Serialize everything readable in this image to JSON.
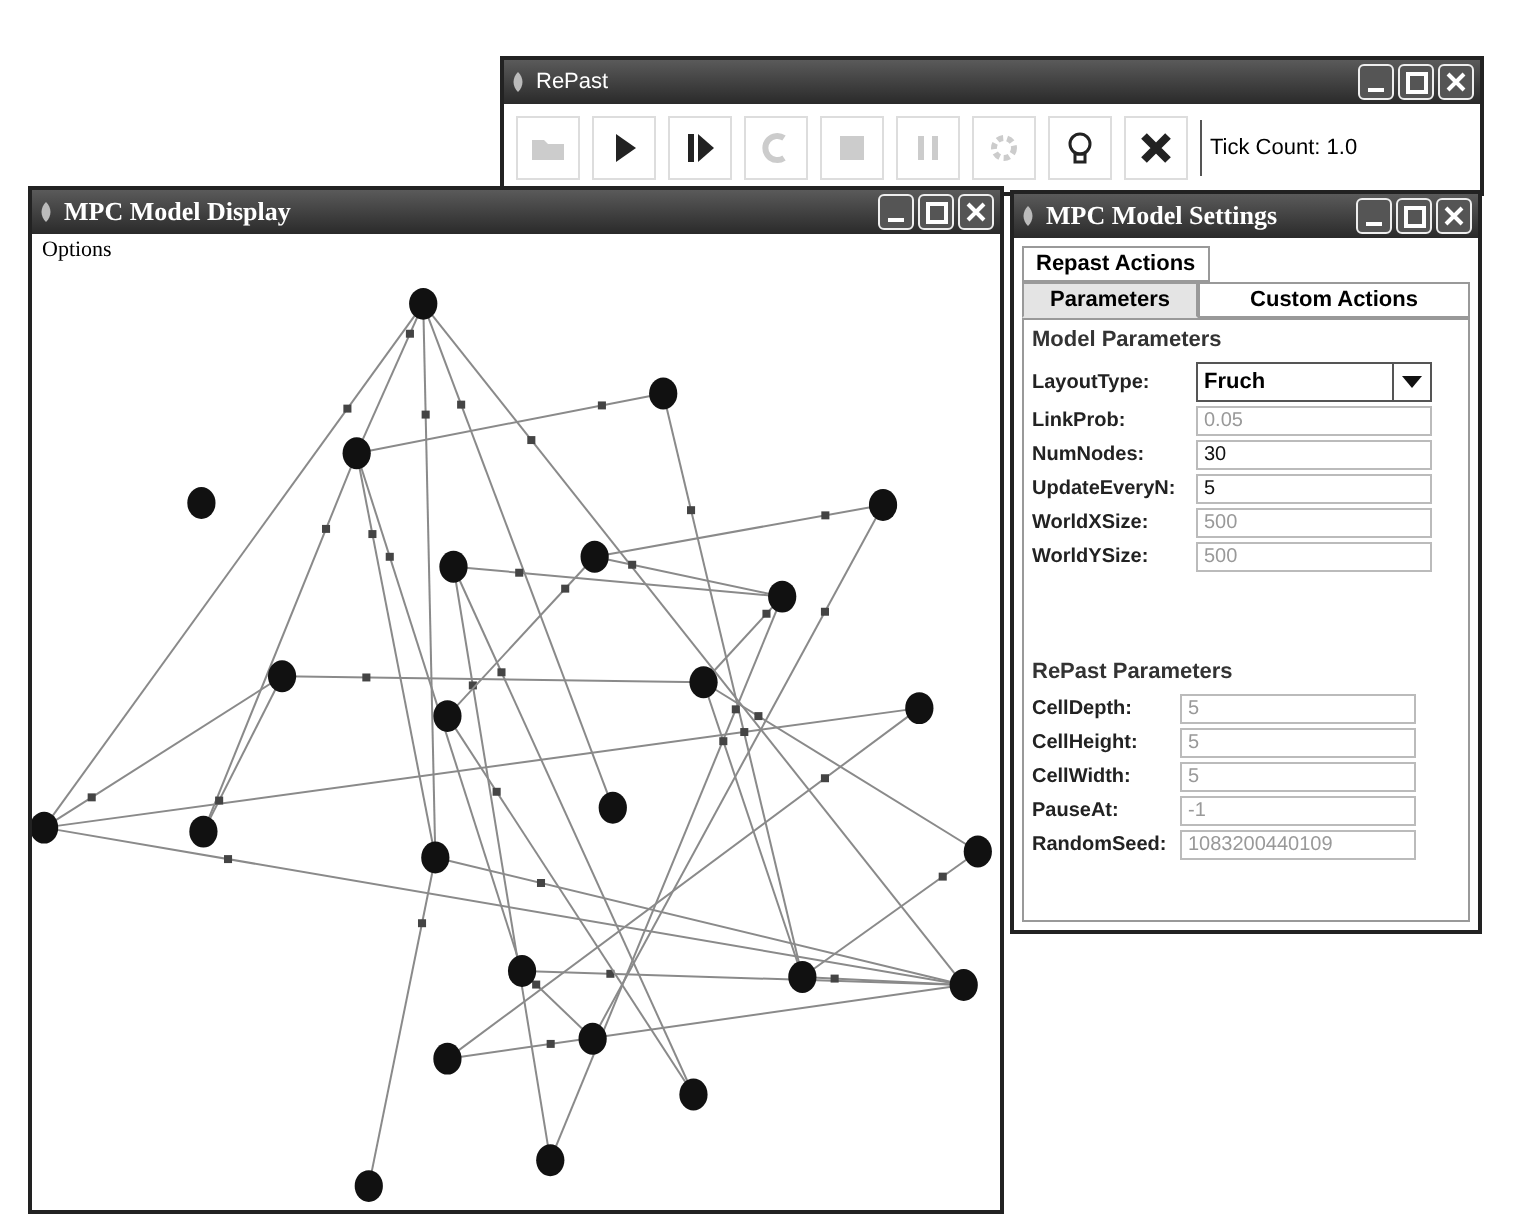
{
  "toolbar_window": {
    "title": "RePast",
    "tools": [
      {
        "kind": "folder",
        "disabled": true
      },
      {
        "kind": "play",
        "disabled": false
      },
      {
        "kind": "step",
        "disabled": false
      },
      {
        "kind": "reset",
        "disabled": true
      },
      {
        "kind": "stop",
        "disabled": true
      },
      {
        "kind": "pause",
        "disabled": true
      },
      {
        "kind": "gear",
        "disabled": true
      },
      {
        "kind": "bulb",
        "disabled": false
      },
      {
        "kind": "exit",
        "disabled": false
      }
    ],
    "tick_count": "Tick Count: 1.0"
  },
  "display_window": {
    "title": "MPC Model Display",
    "menu": [
      "Options"
    ]
  },
  "settings_window": {
    "title": "MPC Model Settings",
    "tab_rows": [
      [
        {
          "label": "Repast Actions",
          "selected": false
        }
      ],
      [
        {
          "label": "Parameters",
          "selected": true
        },
        {
          "label": "Custom Actions",
          "selected": false
        }
      ]
    ],
    "groups": [
      {
        "title": "Model Parameters",
        "fields": [
          {
            "label": "LayoutType:",
            "kind": "dropdown",
            "value": "Fruch",
            "disabled": false
          },
          {
            "label": "LinkProb:",
            "kind": "text",
            "value": "0.05",
            "disabled": true
          },
          {
            "label": "NumNodes:",
            "kind": "text",
            "value": "30",
            "disabled": false
          },
          {
            "label": "UpdateEveryN:",
            "kind": "text",
            "value": "5",
            "disabled": false
          },
          {
            "label": "WorldXSize:",
            "kind": "text",
            "value": "500",
            "disabled": true
          },
          {
            "label": "WorldYSize:",
            "kind": "text",
            "value": "500",
            "disabled": true
          }
        ]
      },
      {
        "title": "RePast Parameters",
        "fields": [
          {
            "label": "CellDepth:",
            "kind": "text",
            "value": "5",
            "disabled": true
          },
          {
            "label": "CellHeight:",
            "kind": "text",
            "value": "5",
            "disabled": true
          },
          {
            "label": "CellWidth:",
            "kind": "text",
            "value": "5",
            "disabled": true
          },
          {
            "label": "PauseAt:",
            "kind": "text",
            "value": "-1",
            "disabled": true
          },
          {
            "label": "RandomSeed:",
            "kind": "text",
            "value": "1083200440109",
            "disabled": true
          }
        ]
      }
    ]
  }
}
